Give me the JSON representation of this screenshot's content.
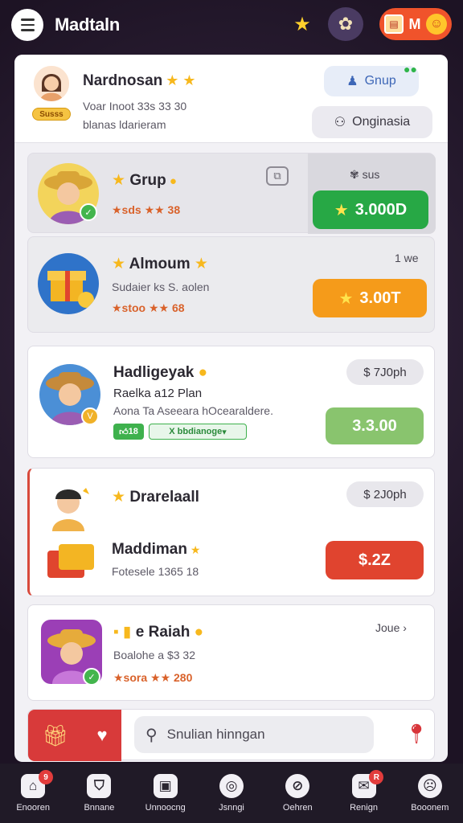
{
  "header": {
    "title": "Madtaln",
    "coin_label": "M",
    "icons": {
      "menu": "menu-icon",
      "star": "star-icon",
      "flower": "flower-icon",
      "coin": "coin-icon"
    }
  },
  "profile": {
    "name": "Nardnosan",
    "stars": "★ ★",
    "badge": "Susss",
    "line1": "Voar Inoot 33s 33 30",
    "line2": "blanas ldarieram",
    "group_button": "Gnup",
    "original_button": "Onginasia"
  },
  "cards": [
    {
      "title": "Grup",
      "rating": "★sds ★★ 38",
      "side_label": "sus",
      "price": "3.000D",
      "price_color": "#27a845"
    },
    {
      "title": "Almoum",
      "subtitle": "Sudaier ks S. aolen",
      "rating": "★stoo ★★ 68",
      "side_label": "1 we",
      "price": "3.00T",
      "price_color": "#f59b1a"
    },
    {
      "title": "Hadligeyak",
      "subtitle": "Raelka a12 Plan",
      "description": "Aona Ta Aseeara hOcearaldere.",
      "tag1": "18",
      "tag2": "X bbdianoge",
      "side_label": "$ 7J0ph",
      "price": "3.3.00",
      "price_color": "#89c46e"
    },
    {
      "title": "Drarelaall",
      "subtitle_title": "Maddiman",
      "subtitle": "Fotesele 1365 18",
      "side_label": "$ 2J0ph",
      "price": "$.2Z",
      "price_color": "#e0442f"
    },
    {
      "title": "e Raiah",
      "subtitle": "Boalohe a $3 32",
      "rating": "★sora ★★ 280",
      "side_label": "Joue"
    }
  ],
  "search": {
    "placeholder": "Snulian hinngan"
  },
  "bottom_nav": [
    {
      "label": "Enooren",
      "icon": "home-icon",
      "badge": "9"
    },
    {
      "label": "Bnnane",
      "icon": "shield-icon",
      "badge": ""
    },
    {
      "label": "Unnoocng",
      "icon": "shop-icon",
      "badge": ""
    },
    {
      "label": "Jsnngi",
      "icon": "target-icon",
      "badge": ""
    },
    {
      "label": "Oehren",
      "icon": "compass-icon",
      "badge": ""
    },
    {
      "label": "Renign",
      "icon": "mail-icon",
      "badge": "R"
    },
    {
      "label": "Booonem",
      "icon": "face-icon",
      "badge": ""
    }
  ]
}
